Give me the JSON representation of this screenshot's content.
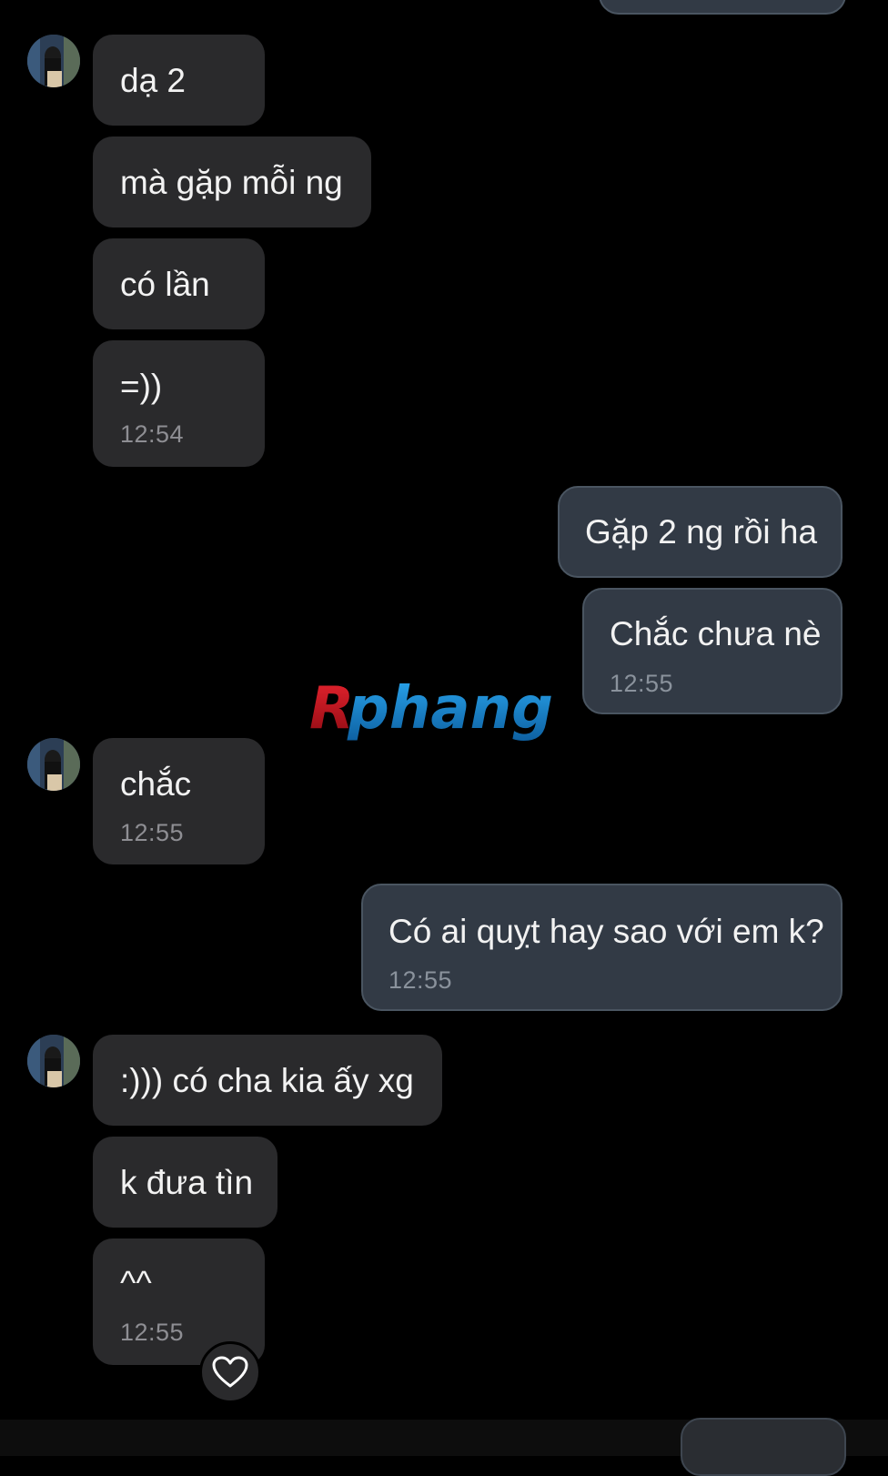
{
  "conversation": {
    "messages": [
      {
        "direction": "incoming",
        "text": "dạ 2",
        "time": ""
      },
      {
        "direction": "incoming",
        "text": "mà gặp mỗi ng",
        "time": ""
      },
      {
        "direction": "incoming",
        "text": "có lần",
        "time": ""
      },
      {
        "direction": "incoming",
        "text": "=))",
        "time": "12:54"
      },
      {
        "direction": "outgoing",
        "text": "Gặp 2 ng rồi ha",
        "time": ""
      },
      {
        "direction": "outgoing",
        "text": "Chắc chưa nè",
        "time": "12:55"
      },
      {
        "direction": "incoming",
        "text": "chắc",
        "time": "12:55"
      },
      {
        "direction": "outgoing",
        "text": "Có ai quỵt hay sao với em k?",
        "time": "12:55"
      },
      {
        "direction": "incoming",
        "text": ":))) có cha kia ấy xg",
        "time": ""
      },
      {
        "direction": "incoming",
        "text": "k đưa tìn",
        "time": ""
      },
      {
        "direction": "incoming",
        "text": "^^",
        "time": "12:55"
      }
    ],
    "reaction": "heart-icon"
  },
  "watermark": {
    "text": "Rphang",
    "colors": [
      "#c8101e",
      "#1c8fd6"
    ]
  },
  "colors": {
    "background": "#000000",
    "incoming_bubble": "#2a2a2c",
    "outgoing_bubble": "#323a45",
    "text": "#f2f2f2",
    "timestamp": "#8e8e93"
  }
}
